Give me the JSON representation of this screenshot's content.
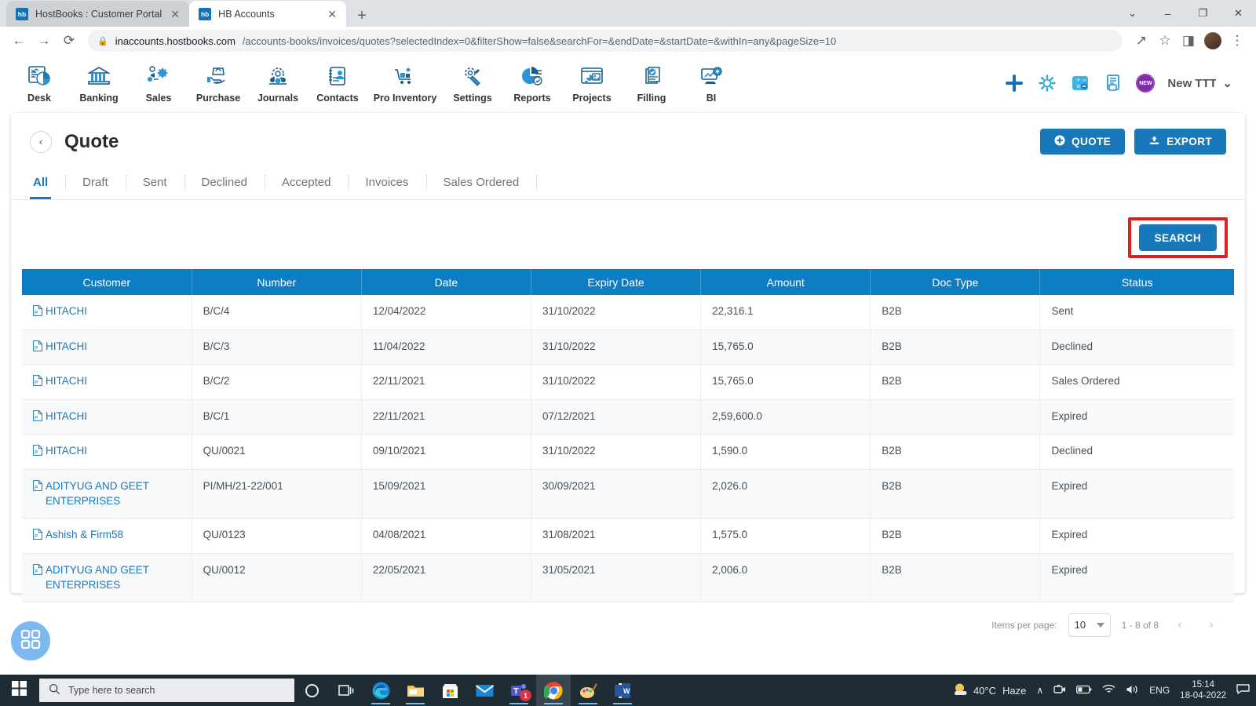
{
  "browser": {
    "tabs": [
      {
        "title": "HostBooks : Customer Portal",
        "favicon": "hb",
        "active": false
      },
      {
        "title": "HB Accounts",
        "favicon": "hb",
        "active": true
      }
    ],
    "new_tab_label": "+",
    "window_controls": {
      "minimize": "–",
      "maximize": "❐",
      "close": "✕",
      "tab_list": "⌄"
    },
    "url_host": "inaccounts.hostbooks.com",
    "url_path": "/accounts-books/invoices/quotes?selectedIndex=0&filterShow=false&searchFor=&endDate=&startDate=&withIn=any&pageSize=10",
    "url_full": "inaccounts.hostbooks.com/accounts-books/invoices/quotes?selectedIndex=0&filterShow=false&searchFor=&endDate=&startDate=&withIn=any&pageSize=10",
    "nav": {
      "back": "←",
      "forward": "→",
      "reload": "⟳"
    }
  },
  "topnav": {
    "modules": [
      {
        "label": "Desk",
        "icon": "dashboard-icon"
      },
      {
        "label": "Banking",
        "icon": "bank-icon"
      },
      {
        "label": "Sales",
        "icon": "sales-icon"
      },
      {
        "label": "Purchase",
        "icon": "purchase-icon"
      },
      {
        "label": "Journals",
        "icon": "journals-icon"
      },
      {
        "label": "Contacts",
        "icon": "contacts-icon"
      },
      {
        "label": "Pro Inventory",
        "icon": "inventory-icon"
      },
      {
        "label": "Settings",
        "icon": "settings-icon"
      },
      {
        "label": "Reports",
        "icon": "reports-icon"
      },
      {
        "label": "Projects",
        "icon": "projects-icon"
      },
      {
        "label": "Filling",
        "icon": "filling-icon"
      },
      {
        "label": "BI",
        "icon": "bi-icon"
      }
    ],
    "actions": {
      "add": "+",
      "settings_icon": "gear-icon",
      "calculator_icon": "calculator-icon",
      "notes_icon": "notes-icon",
      "new_badge": "NEW"
    },
    "user": {
      "name": "New TTT",
      "chevron": "⌄"
    }
  },
  "page": {
    "back_arrow": "‹",
    "title": "Quote",
    "buttons": {
      "quote": "QUOTE",
      "quote_icon": "plus-circle-icon",
      "export": "EXPORT",
      "export_icon": "upload-icon"
    },
    "tabs": [
      {
        "label": "All",
        "active": true
      },
      {
        "label": "Draft",
        "active": false
      },
      {
        "label": "Sent",
        "active": false
      },
      {
        "label": "Declined",
        "active": false
      },
      {
        "label": "Accepted",
        "active": false
      },
      {
        "label": "Invoices",
        "active": false
      },
      {
        "label": "Sales Ordered",
        "active": false
      }
    ],
    "search_button": "SEARCH",
    "highlight_color": "#e02020"
  },
  "table": {
    "columns": [
      "Customer",
      "Number",
      "Date",
      "Expiry Date",
      "Amount",
      "Doc Type",
      "Status"
    ],
    "rows": [
      {
        "customer": "HITACHI",
        "number": "B/C/4",
        "date": "12/04/2022",
        "expiry": "31/10/2022",
        "amount": "22,316.1",
        "doctype": "B2B",
        "status": "Sent"
      },
      {
        "customer": "HITACHI",
        "number": "B/C/3",
        "date": "11/04/2022",
        "expiry": "31/10/2022",
        "amount": "15,765.0",
        "doctype": "B2B",
        "status": "Declined"
      },
      {
        "customer": "HITACHI",
        "number": "B/C/2",
        "date": "22/11/2021",
        "expiry": "31/10/2022",
        "amount": "15,765.0",
        "doctype": "B2B",
        "status": "Sales Ordered"
      },
      {
        "customer": "HITACHI",
        "number": "B/C/1",
        "date": "22/11/2021",
        "expiry": "07/12/2021",
        "amount": "2,59,600.0",
        "doctype": "",
        "status": "Expired"
      },
      {
        "customer": "HITACHI",
        "number": "QU/0021",
        "date": "09/10/2021",
        "expiry": "31/10/2022",
        "amount": "1,590.0",
        "doctype": "B2B",
        "status": "Declined"
      },
      {
        "customer": "ADITYUG AND GEET ENTERPRISES",
        "number": "PI/MH/21-22/001",
        "date": "15/09/2021",
        "expiry": "30/09/2021",
        "amount": "2,026.0",
        "doctype": "B2B",
        "status": "Expired"
      },
      {
        "customer": "Ashish & Firm58",
        "number": "QU/0123",
        "date": "04/08/2021",
        "expiry": "31/08/2021",
        "amount": "1,575.0",
        "doctype": "B2B",
        "status": "Expired"
      },
      {
        "customer": "ADITYUG AND GEET ENTERPRISES",
        "number": "QU/0012",
        "date": "22/05/2021",
        "expiry": "31/05/2021",
        "amount": "2,006.0",
        "doctype": "B2B",
        "status": "Expired"
      }
    ]
  },
  "pagination": {
    "items_per_page_label": "Items per page:",
    "items_per_page_value": "10",
    "range": "1 - 8 of 8",
    "prev": "‹",
    "next": "›"
  },
  "fab": {
    "icon": "grid-apps-icon"
  },
  "taskbar": {
    "start_icon": "windows-icon",
    "search_placeholder": "Type here to search",
    "search_icon": "magnifier-icon",
    "cortana_icon": "cortana-icon",
    "taskview_icon": "task-view-icon",
    "apps": [
      {
        "name": "edge-icon",
        "open": true,
        "active": false,
        "badge": ""
      },
      {
        "name": "file-explorer-icon",
        "open": true,
        "active": false,
        "badge": ""
      },
      {
        "name": "microsoft-store-icon",
        "open": false,
        "active": false,
        "badge": ""
      },
      {
        "name": "mail-icon",
        "open": false,
        "active": false,
        "badge": ""
      },
      {
        "name": "teams-icon",
        "open": true,
        "active": false,
        "badge": "1"
      },
      {
        "name": "chrome-icon",
        "open": true,
        "active": true,
        "badge": ""
      },
      {
        "name": "paint-icon",
        "open": true,
        "active": false,
        "badge": ""
      },
      {
        "name": "word-icon",
        "open": true,
        "active": false,
        "badge": ""
      }
    ],
    "tray": {
      "weather_temp": "40°C",
      "weather_cond": "Haze",
      "overflow": "∧",
      "camera_icon": "camera-icon",
      "battery_icon": "battery-icon",
      "wifi_icon": "wifi-icon",
      "volume_icon": "volume-icon",
      "language": "ENG",
      "time": "15:14",
      "date": "18-04-2022",
      "action_center_icon": "notification-icon"
    }
  }
}
